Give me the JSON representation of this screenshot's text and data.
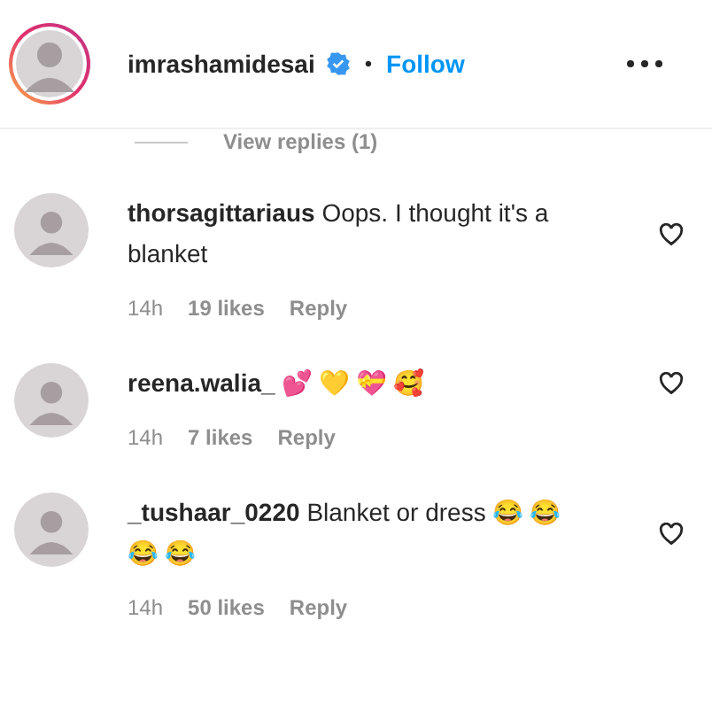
{
  "header": {
    "username": "imrashamidesai",
    "verified": true,
    "separator": "•",
    "follow": "Follow"
  },
  "view_replies": "View replies (1)",
  "comments": [
    {
      "username": "thorsagittariaus",
      "text": "Oops. I thought it's a blanket",
      "time": "14h",
      "likes": "19 likes",
      "reply": "Reply"
    },
    {
      "username": "reena.walia_",
      "text": "💕 💛 💝 🥰",
      "time": "14h",
      "likes": "7 likes",
      "reply": "Reply"
    },
    {
      "username": "_tushaar_0220",
      "text": "Blanket or dress 😂 😂 😂 😂",
      "time": "14h",
      "likes": "50 likes",
      "reply": "Reply"
    }
  ]
}
